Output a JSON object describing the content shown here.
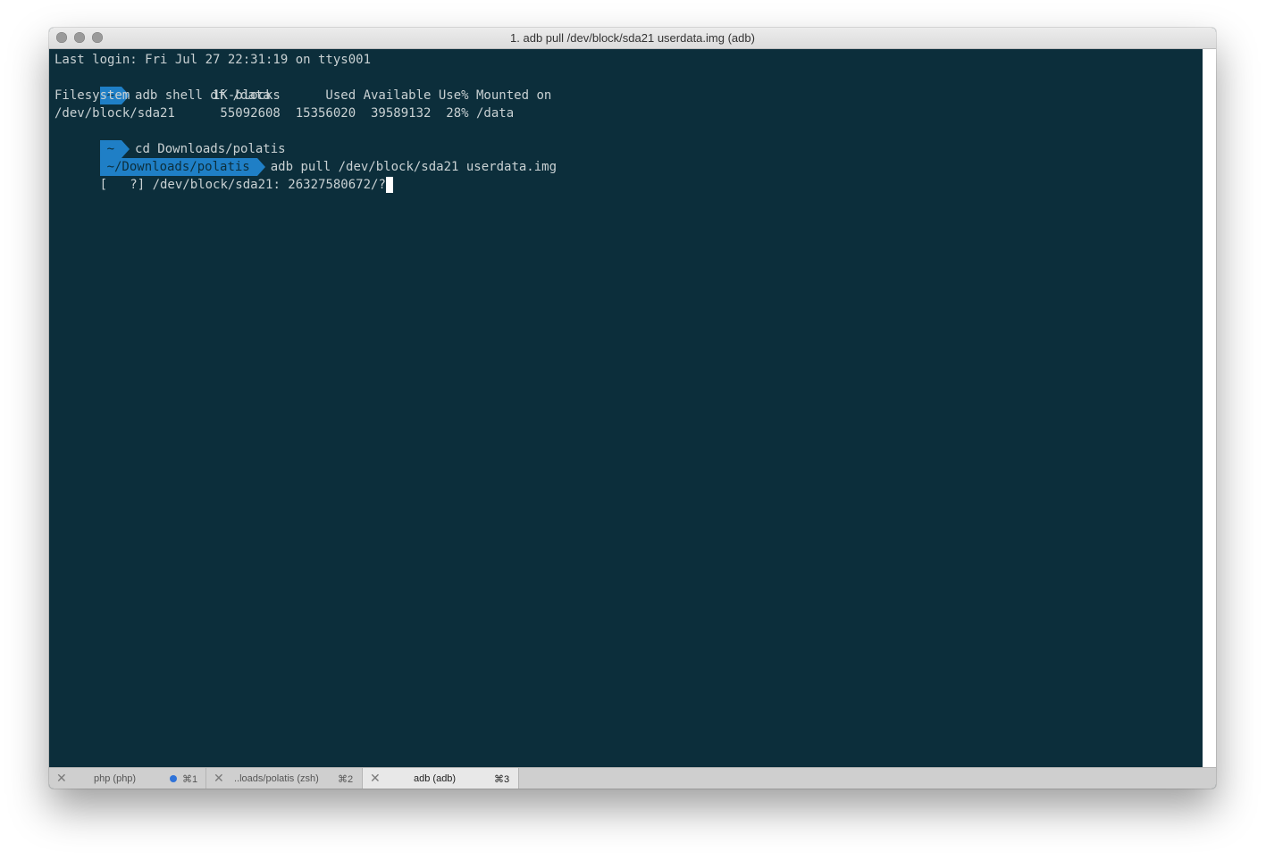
{
  "window": {
    "title": "1. adb pull /dev/block/sda21 userdata.img (adb)"
  },
  "terminal": {
    "login_line": "Last login: Fri Jul 27 22:31:19 on ttys001",
    "prompt1": {
      "dir": "~",
      "command": "adb shell df /data"
    },
    "df_header": "Filesystem           1K-blocks      Used Available Use% Mounted on",
    "df_row": "/dev/block/sda21      55092608  15356020  39589132  28% /data",
    "prompt2": {
      "dir": "~",
      "command": "cd Downloads/polatis"
    },
    "prompt3": {
      "dir": "~/Downloads/polatis",
      "command": "adb pull /dev/block/sda21 userdata.img"
    },
    "progress_line": "[   ?] /dev/block/sda21: 26327580672/?"
  },
  "tabs": [
    {
      "label": "php (php)",
      "shortcut": "⌘1",
      "activity": true
    },
    {
      "label": "..loads/polatis (zsh)",
      "shortcut": "⌘2",
      "activity": false
    },
    {
      "label": "adb (adb)",
      "shortcut": "⌘3",
      "activity": false
    }
  ],
  "colors": {
    "terminal_bg": "#0c2e3b",
    "prompt_segment": "#1f7fc6",
    "foreground": "#c9d1d3",
    "activity_dot": "#2f73d9"
  },
  "icons": {
    "close": "close-icon",
    "traffic_lights": [
      "close-window-icon",
      "minimize-window-icon",
      "zoom-window-icon"
    ]
  }
}
